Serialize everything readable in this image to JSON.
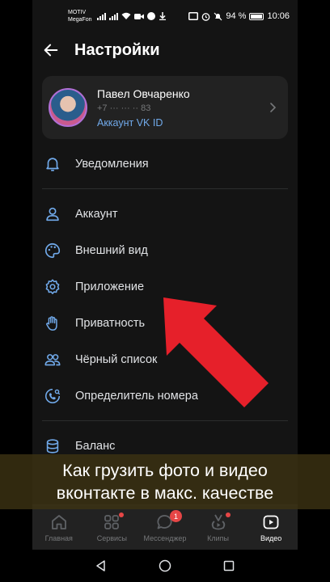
{
  "status_bar": {
    "carrier_1": "MOTIV",
    "carrier_2": "MegaFon",
    "battery": "94 %",
    "time": "10:06",
    "battery_level": 0.94
  },
  "header": {
    "title": "Настройки",
    "back_icon": "arrow-left-icon"
  },
  "profile": {
    "name": "Павел Овчаренко",
    "phone": "+7 ··· ··· ·· 83",
    "link": "Аккаунт VK ID"
  },
  "menu": {
    "group1": [
      {
        "label": "Уведомления",
        "icon": "bell-icon"
      }
    ],
    "group2": [
      {
        "label": "Аккаунт",
        "icon": "user-icon"
      },
      {
        "label": "Внешний вид",
        "icon": "palette-icon"
      },
      {
        "label": "Приложение",
        "icon": "gear-icon"
      },
      {
        "label": "Приватность",
        "icon": "hand-icon"
      },
      {
        "label": "Чёрный список",
        "icon": "users-icon"
      },
      {
        "label": "Определитель номера",
        "icon": "phone-search-icon"
      }
    ],
    "group3": [
      {
        "label": "Баланс",
        "icon": "coins-icon"
      }
    ]
  },
  "tabs": [
    {
      "label": "Главная",
      "icon": "home-icon"
    },
    {
      "label": "Сервисы",
      "icon": "services-icon",
      "dot": true
    },
    {
      "label": "Мессенджер",
      "icon": "message-icon",
      "badge": "1"
    },
    {
      "label": "Клипы",
      "icon": "clips-icon",
      "dot": true
    },
    {
      "label": "Видео",
      "icon": "video-icon",
      "active": true
    }
  ],
  "caption": {
    "line1": "Как грузить фото и видео",
    "line2": "вконтакте в макс. качестве"
  },
  "colors": {
    "accent": "#71aaeb",
    "arrow": "#e6202a",
    "badge": "#e64646",
    "background": "#141414"
  }
}
